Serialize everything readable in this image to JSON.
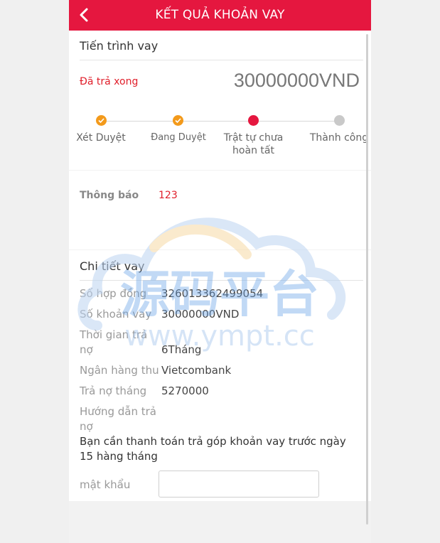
{
  "header": {
    "title": "KẾT QUẢ KHOẢN VAY",
    "back_icon": "‹"
  },
  "progress": {
    "section_title": "Tiến trình vay",
    "status": "Đã trả xong",
    "amount": "30000000VND",
    "steps": [
      {
        "label": "Xét Duyệt",
        "state": "done"
      },
      {
        "label": "Đang Duyệt",
        "state": "done"
      },
      {
        "label": "Trật tự chưa hoàn tất",
        "state": "current"
      },
      {
        "label": "Thành công",
        "state": "todo"
      }
    ]
  },
  "notice": {
    "label": "Thông báo",
    "value": "123"
  },
  "details": {
    "section_title": "Chi tiết vay",
    "rows": [
      {
        "label": "Số hợp đồng",
        "value": "326013362499054"
      },
      {
        "label": "Số khoản vay",
        "value": "30000000VND"
      },
      {
        "label": "Thời gian trả nợ",
        "value": "6Tháng"
      },
      {
        "label": "Ngân hàng thu",
        "value": "Vietcombank"
      },
      {
        "label": "Trả nợ tháng",
        "value": "5270000"
      },
      {
        "label": "Hướng dẫn trả nợ",
        "value": ""
      }
    ],
    "guide_text": "Bạn cần thanh toán trả góp khoản vay trước ngày 15 hàng tháng",
    "password_label": "mật khẩu",
    "password_value": ""
  },
  "watermark": {
    "text_cn": "源码平台",
    "text_url": "www.ympt.cc"
  },
  "colors": {
    "brand_red": "#e5173f",
    "step_done": "#f39a1b",
    "step_todo": "#c9c9c9",
    "status_red": "#e01e2a"
  }
}
